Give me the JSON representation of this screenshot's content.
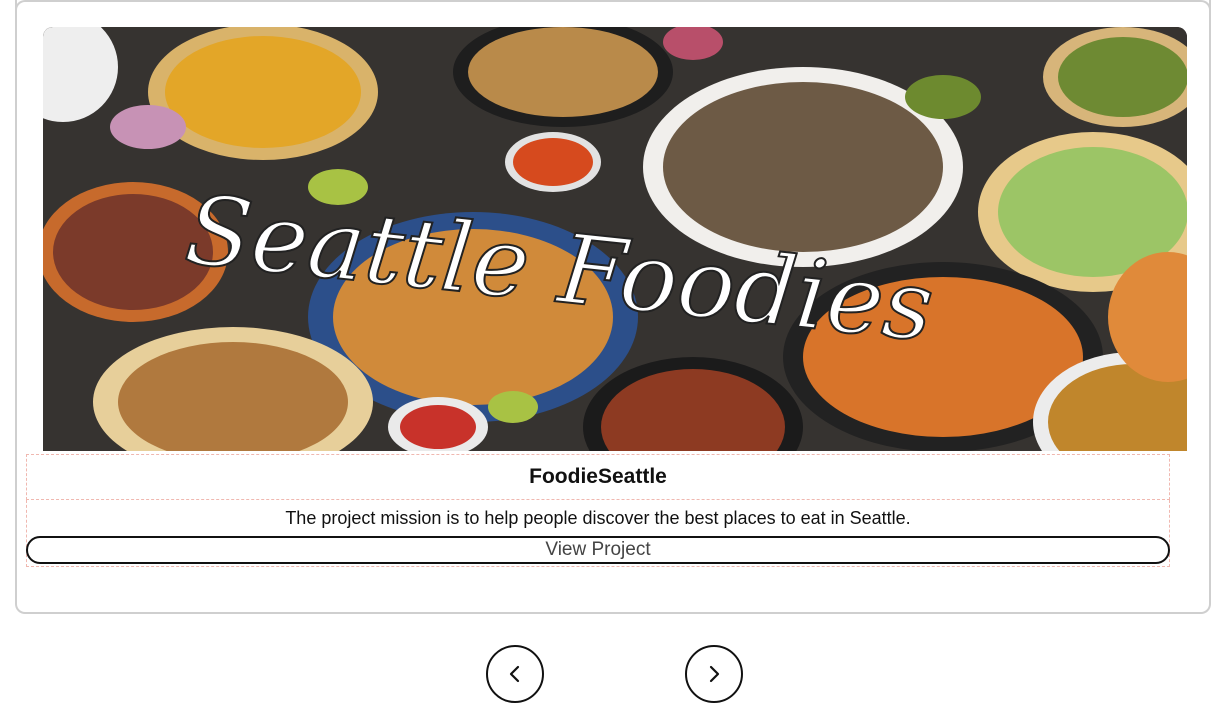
{
  "card": {
    "image_alt_text": "Seattle Foodies",
    "title": "FoodieSeattle",
    "description": "The project mission is to help people discover the best places to eat in Seattle.",
    "view_button_label": "View Project"
  },
  "nav": {
    "prev_icon": "chevron-left-icon",
    "next_icon": "chevron-right-icon"
  },
  "colors": {
    "border": "#cfcfcf",
    "dashed_outline": "#f0b8b0",
    "text": "#111111"
  }
}
